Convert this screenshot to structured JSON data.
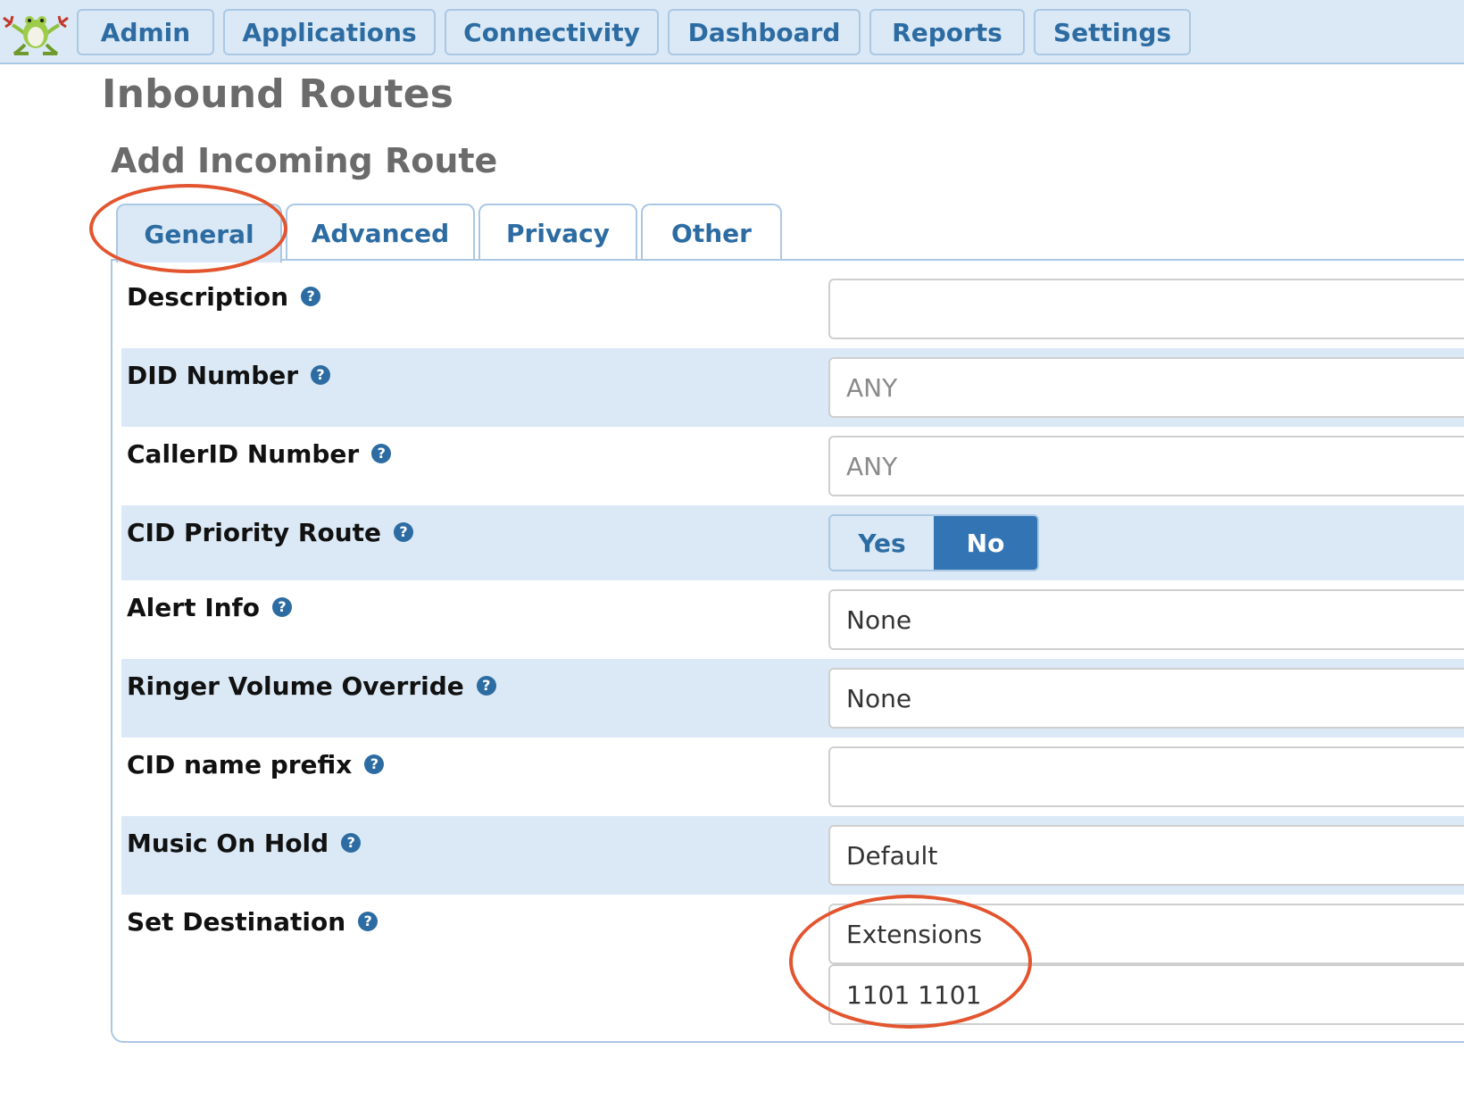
{
  "nav": {
    "items": [
      {
        "label": "Admin"
      },
      {
        "label": "Applications"
      },
      {
        "label": "Connectivity"
      },
      {
        "label": "Dashboard"
      },
      {
        "label": "Reports"
      },
      {
        "label": "Settings"
      }
    ]
  },
  "page": {
    "title": "Inbound Routes",
    "section_title": "Add Incoming Route"
  },
  "tabs": [
    {
      "label": "General",
      "active": true
    },
    {
      "label": "Advanced",
      "active": false
    },
    {
      "label": "Privacy",
      "active": false
    },
    {
      "label": "Other",
      "active": false
    }
  ],
  "form": {
    "description": {
      "label": "Description",
      "value": ""
    },
    "did_number": {
      "label": "DID Number",
      "placeholder": "ANY"
    },
    "callerid_number": {
      "label": "CallerID Number",
      "placeholder": "ANY"
    },
    "cid_priority_route": {
      "label": "CID Priority Route",
      "options": [
        "Yes",
        "No"
      ],
      "selected": "No"
    },
    "alert_info": {
      "label": "Alert Info",
      "value": "None"
    },
    "ringer_volume_override": {
      "label": "Ringer Volume Override",
      "value": "None"
    },
    "cid_name_prefix": {
      "label": "CID name prefix",
      "value": ""
    },
    "music_on_hold": {
      "label": "Music On Hold",
      "value": "Default"
    },
    "set_destination": {
      "label": "Set Destination",
      "type_value": "Extensions",
      "target_value": "1101 1101"
    }
  },
  "help_icon_glyph": "?",
  "colors": {
    "nav_bg": "#dbe9f6",
    "accent": "#2d6ca2",
    "toggle_selected": "#3374b5",
    "annotation": "#e2552f"
  }
}
